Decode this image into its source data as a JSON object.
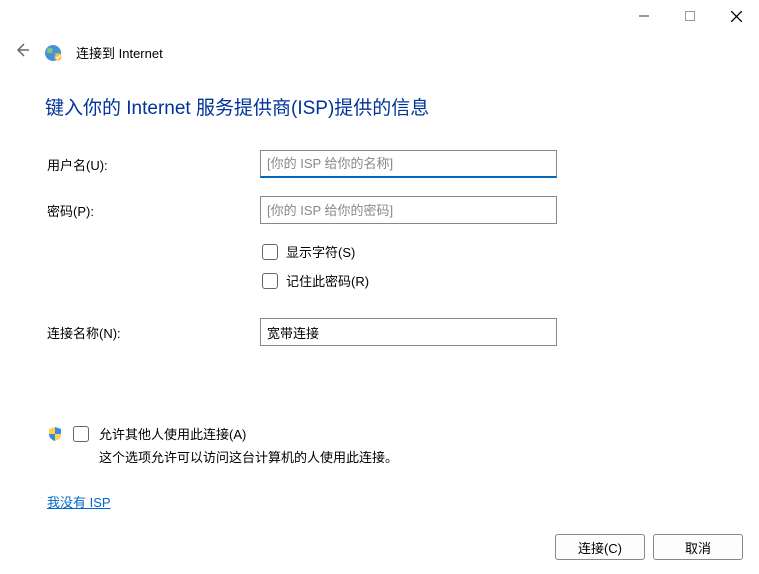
{
  "window": {
    "title": "连接到 Internet"
  },
  "heading": "键入你的 Internet 服务提供商(ISP)提供的信息",
  "form": {
    "username_label": "用户名(U):",
    "username_placeholder": "[你的 ISP 给你的名称]",
    "username_value": "",
    "password_label": "密码(P):",
    "password_placeholder": "[你的 ISP 给你的密码]",
    "password_value": "",
    "show_chars_label": "显示字符(S)",
    "remember_pw_label": "记住此密码(R)",
    "conn_name_label": "连接名称(N):",
    "conn_name_value": "宽带连接"
  },
  "allow": {
    "label": "允许其他人使用此连接(A)",
    "desc": "这个选项允许可以访问这台计算机的人使用此连接。"
  },
  "link_no_isp": "我没有 ISP",
  "buttons": {
    "connect": "连接(C)",
    "cancel": "取消"
  }
}
